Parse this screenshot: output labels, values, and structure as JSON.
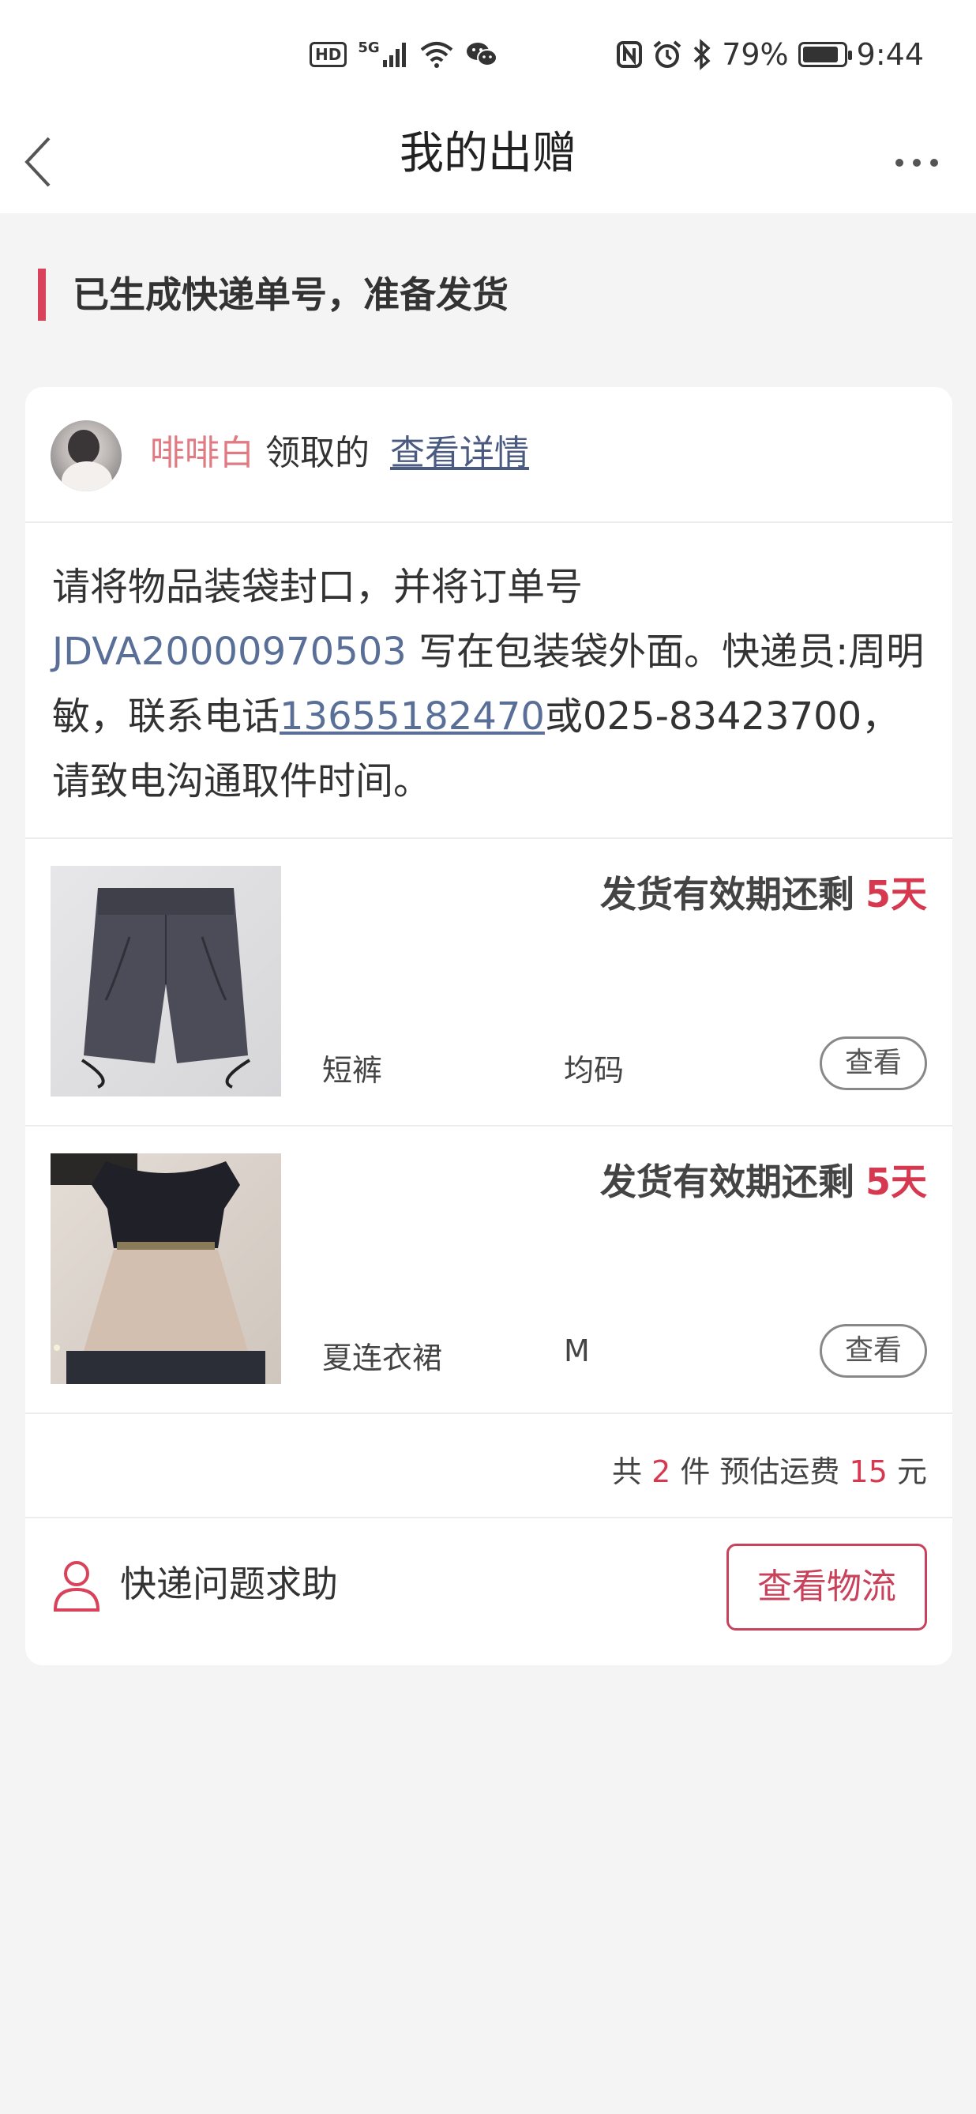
{
  "status_bar": {
    "hd": "HD",
    "network": "5G",
    "battery": "79%",
    "battery_level": 0.79,
    "time": "9:44",
    "icons": [
      "hd-icon",
      "signal-icon",
      "wifi-icon",
      "wechat-icon",
      "nfc-icon",
      "alarm-icon",
      "bluetooth-icon",
      "battery-icon"
    ]
  },
  "header": {
    "title": "我的出赠"
  },
  "section": {
    "title": "已生成快递单号，准备发货"
  },
  "card": {
    "recipient_name": "啡啡白",
    "received_text": "领取的",
    "detail_link": "查看详情",
    "instruction_prefix": "请将物品装袋封口，并将订单号 ",
    "order_no": "JDVA20000970503",
    "instruction_mid": " 写在包装袋外面。快递员:周明敏，联系电话",
    "phone": "13655182470",
    "instruction_suffix": "或025-83423700，请致电沟通取件时间。",
    "items": [
      {
        "deadline_label": "发货有效期还剩",
        "days": "5天",
        "name": "短裤",
        "size": "均码",
        "view_label": "查看"
      },
      {
        "deadline_label": "发货有效期还剩",
        "days": "5天",
        "name": "夏连衣裙",
        "size": "M",
        "view_label": "查看"
      }
    ],
    "summary": {
      "prefix": "共",
      "count": "2",
      "unit": "件 预估运费",
      "fee": "15",
      "currency": "元"
    },
    "help_text": "快递问题求助",
    "track_button": "查看物流"
  },
  "colors": {
    "accent": "#d6394f",
    "link": "#5a6f98",
    "background": "#f4f4f5"
  }
}
